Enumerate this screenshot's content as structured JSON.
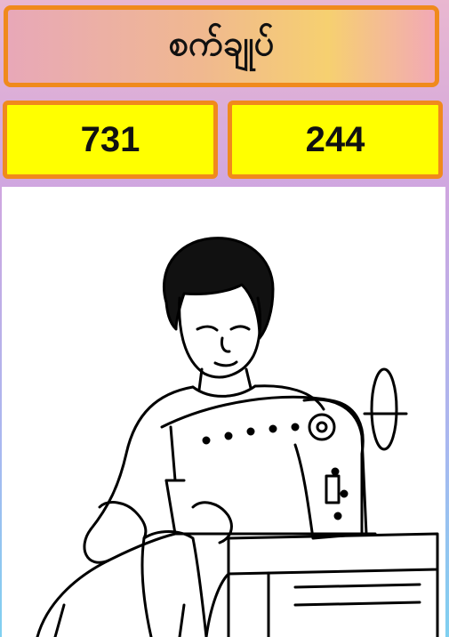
{
  "header": {
    "title": "စက်ချုပ်"
  },
  "scores": {
    "left": "731",
    "right": "244"
  },
  "colors": {
    "box_border": "#f08a1c",
    "score_fill": "#ffff00",
    "picture_background": "#ffffff"
  },
  "picture": {
    "icon": "person-sewing-machine-illustration"
  }
}
